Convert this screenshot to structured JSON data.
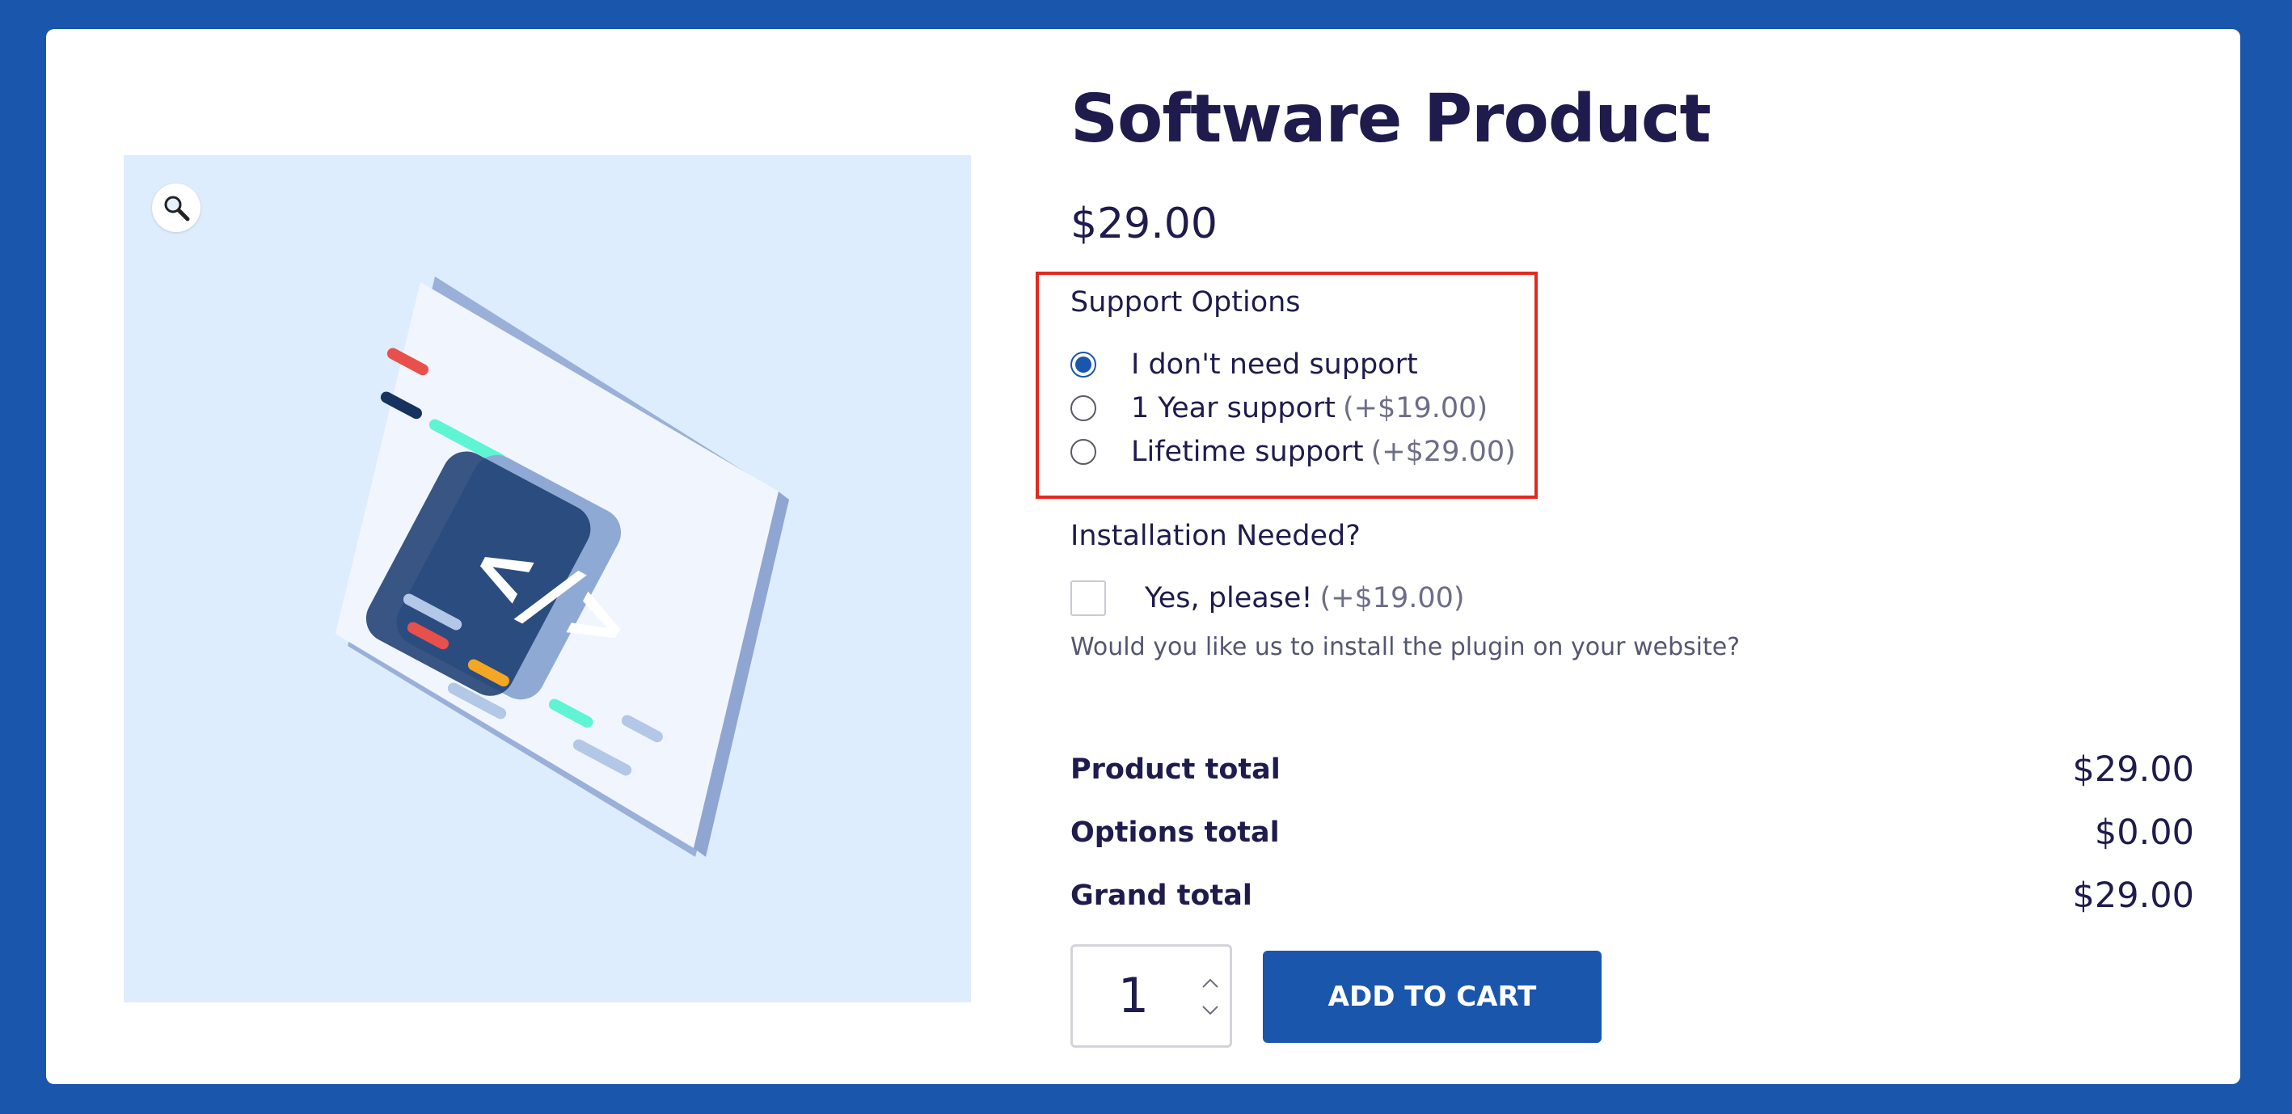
{
  "product": {
    "title": "Software Product",
    "price": "$29.00"
  },
  "support_options": {
    "title": "Support Options",
    "options": [
      {
        "label": "I don't need support",
        "price": "",
        "selected": true
      },
      {
        "label": "1 Year support",
        "price": "(+$19.00)",
        "selected": false
      },
      {
        "label": "Lifetime support",
        "price": "(+$29.00)",
        "selected": false
      }
    ]
  },
  "installation": {
    "title": "Installation Needed?",
    "option_label": "Yes, please!",
    "option_price": "(+$19.00)",
    "checked": false,
    "description": "Would you like us to install the plugin on your website?"
  },
  "totals": [
    {
      "label": "Product total",
      "value": "$29.00"
    },
    {
      "label": "Options total",
      "value": "$0.00"
    },
    {
      "label": "Grand total",
      "value": "$29.00"
    }
  ],
  "cart": {
    "quantity": "1",
    "add_to_cart_label": "ADD TO CART"
  },
  "colors": {
    "brand": "#1a56ac",
    "highlight_border": "#e2291f",
    "text": "#1f1b4d"
  },
  "icons": {
    "zoom": "magnifier-icon",
    "illustration": "code-window-illustration"
  }
}
